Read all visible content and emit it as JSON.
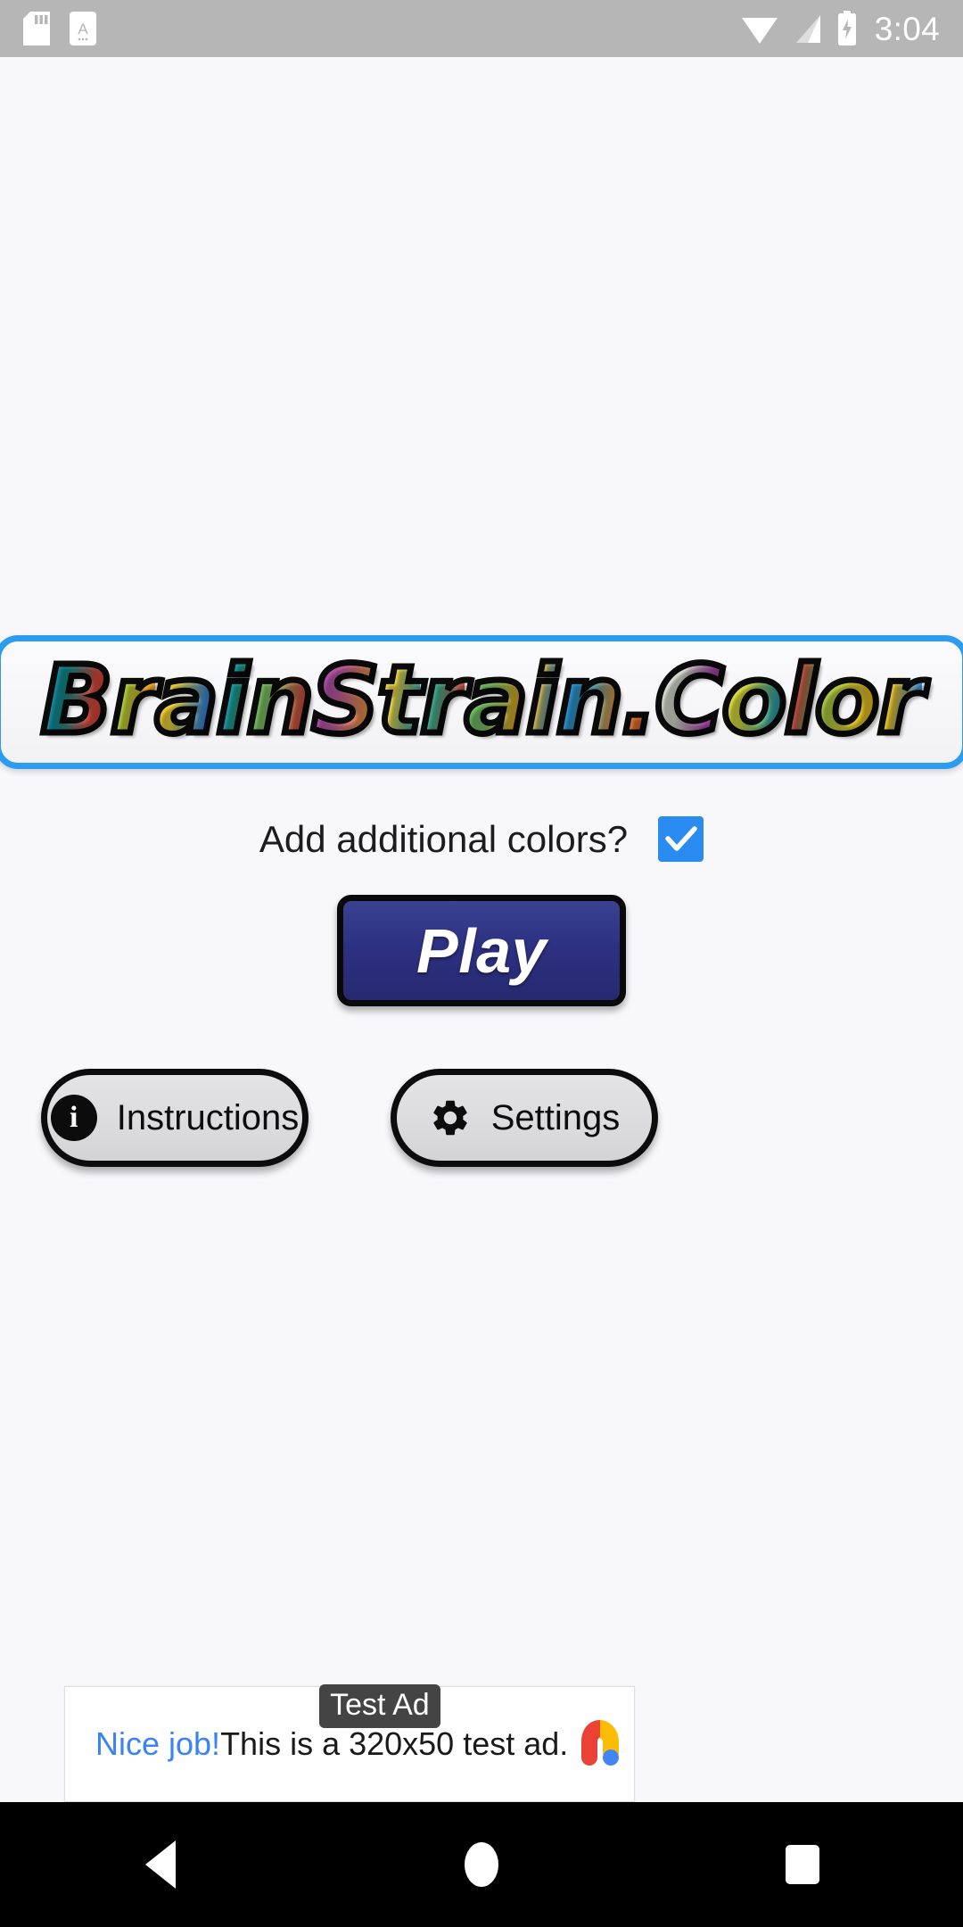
{
  "statusbar": {
    "time": "3:04",
    "icons": [
      "sd-card-icon",
      "document-a-icon",
      "wifi-icon",
      "cellular-signal-icon",
      "battery-charging-icon"
    ]
  },
  "logo": {
    "title": "BrainStrain.Color",
    "border_color": "#2c9cf0",
    "letters": [
      {
        "ch": "B",
        "cls": "g1"
      },
      {
        "ch": "r",
        "cls": "g2"
      },
      {
        "ch": "a",
        "cls": "g3"
      },
      {
        "ch": "i",
        "cls": "g4"
      },
      {
        "ch": "n",
        "cls": "g5"
      },
      {
        "ch": "S",
        "cls": "g7"
      },
      {
        "ch": "t",
        "cls": "g8"
      },
      {
        "ch": "r",
        "cls": "g9"
      },
      {
        "ch": "a",
        "cls": "g10"
      },
      {
        "ch": "i",
        "cls": "g11"
      },
      {
        "ch": "n",
        "cls": "g12"
      },
      {
        "ch": ".",
        "cls": "g13"
      },
      {
        "ch": "C",
        "cls": "g14"
      },
      {
        "ch": "o",
        "cls": "g15"
      },
      {
        "ch": "l",
        "cls": "g16"
      },
      {
        "ch": "o",
        "cls": "g17"
      },
      {
        "ch": "r",
        "cls": "g18"
      }
    ]
  },
  "options": {
    "additional_colors_label": "Add additional colors?",
    "additional_colors_checked": true,
    "checkbox_color": "#2a8cf0"
  },
  "buttons": {
    "play_label": "Play",
    "play_color": "#2c3080",
    "instructions_label": "Instructions",
    "settings_label": "Settings"
  },
  "ad": {
    "cta": "Nice job!",
    "badge": "Test Ad",
    "body": "This is a 320x50 test ad.",
    "cta_color": "#3b82f6",
    "badge_bg": "#444444",
    "logo_colors": {
      "red": "#ea4335",
      "yellow": "#fbbc04",
      "blue": "#4285f4"
    }
  },
  "navbar": {
    "back": "back-button",
    "home": "home-button",
    "recents": "recents-button"
  }
}
